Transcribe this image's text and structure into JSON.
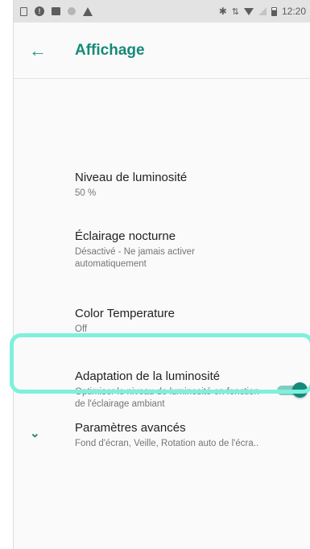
{
  "status_bar": {
    "time": "12:20",
    "icons_left": [
      "sim-card-icon",
      "info-icon",
      "image-icon",
      "circle-icon",
      "warning-icon"
    ],
    "icons_right": [
      "bluetooth-icon",
      "data-arrows-icon",
      "wifi-icon",
      "signal-icon",
      "battery-icon"
    ]
  },
  "app_bar": {
    "title": "Affichage",
    "back_icon": "←",
    "accent_color": "#168a79"
  },
  "settings": [
    {
      "title": "Niveau de luminosité",
      "subtitle": "50 %"
    },
    {
      "title": "Éclairage nocturne",
      "subtitle": "Désactivé - Ne jamais activer automatiquement"
    },
    {
      "title": "Color Temperature",
      "subtitle": "Off"
    },
    {
      "title": "Adaptation de la luminosité",
      "subtitle": "Optimiser le niveau de luminosité en fonction de l'éclairage ambiant",
      "toggle_on": true
    }
  ],
  "advanced": {
    "title": "Paramètres avancés",
    "subtitle": "Fond d'écran, Veille, Rotation auto de l'écra..",
    "chevron": "⌄",
    "highlight_color": "#7ff0dc"
  }
}
